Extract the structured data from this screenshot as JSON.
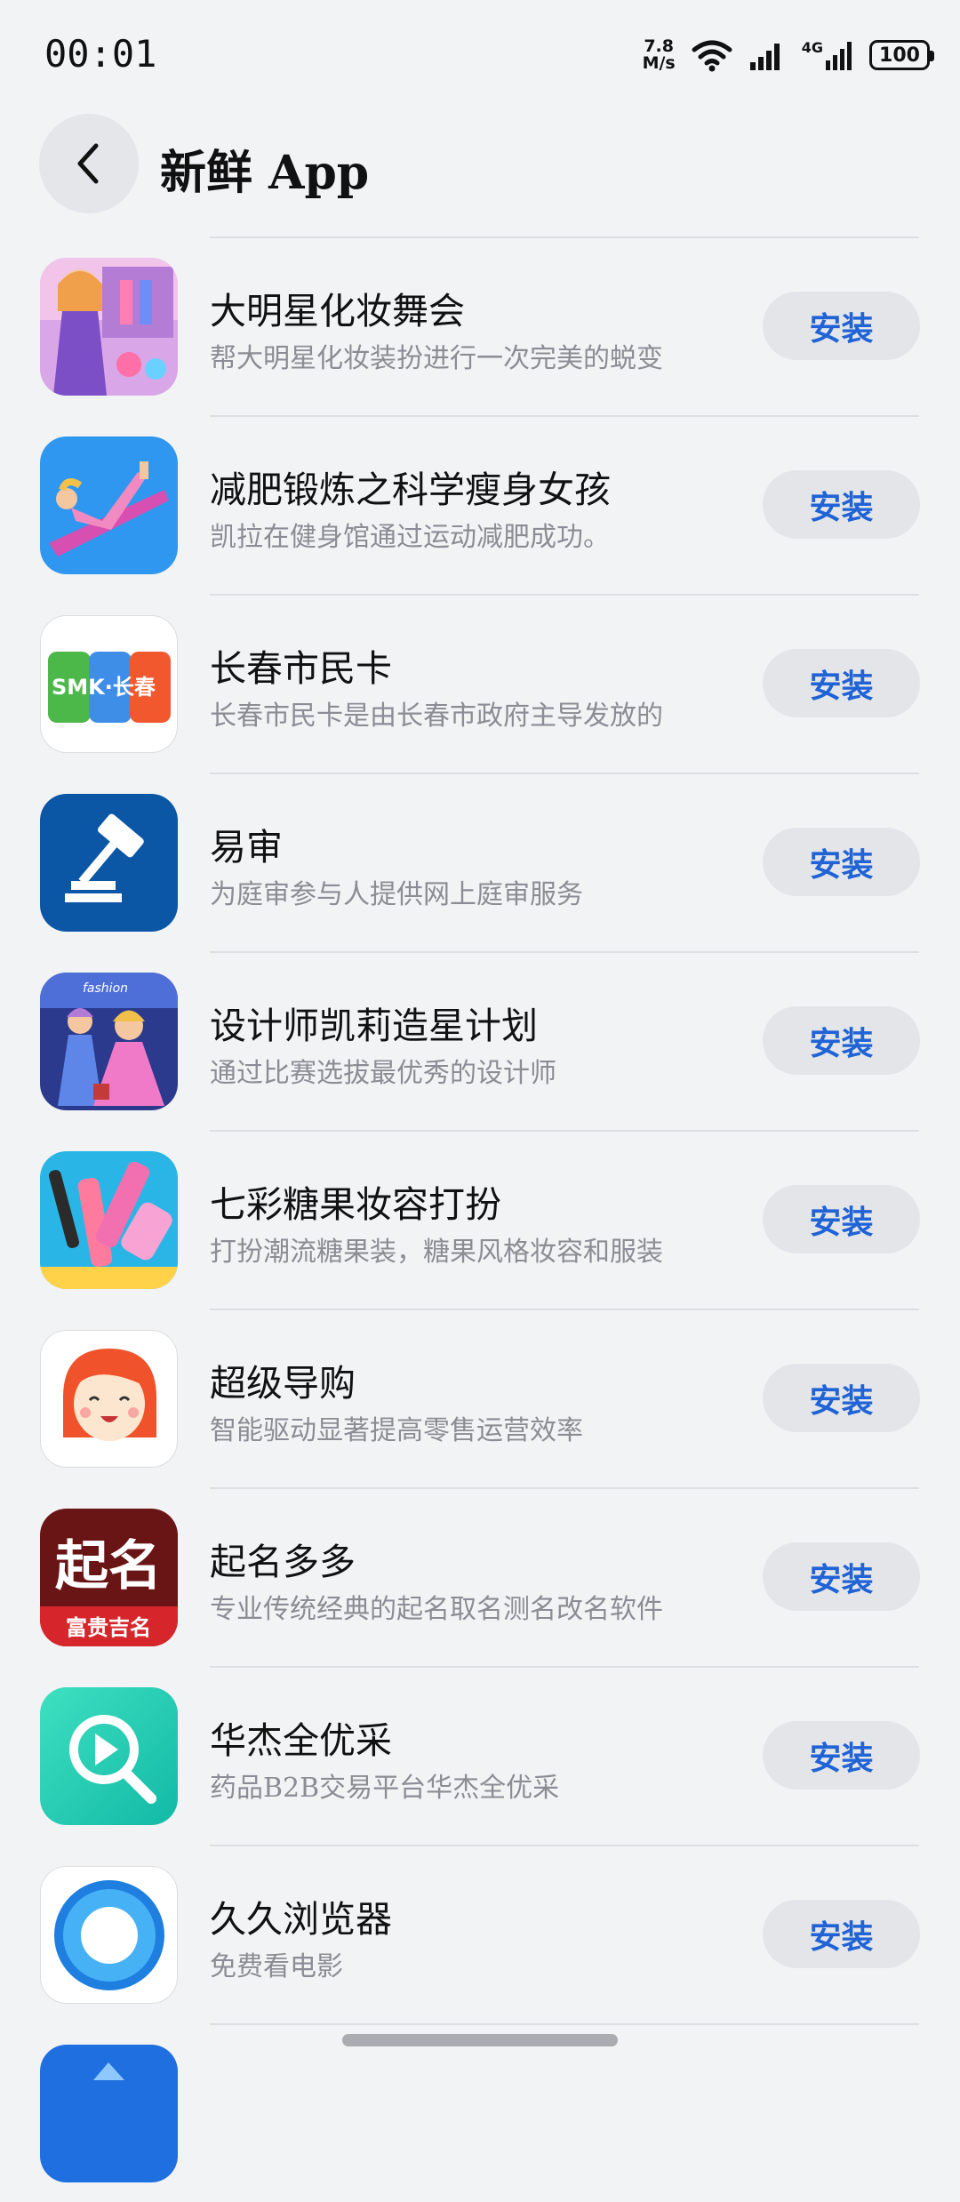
{
  "status_bar": {
    "time": "00:01",
    "net_speed_value": "7.8",
    "net_speed_unit": "M/s",
    "network": "4G",
    "battery": "100"
  },
  "header": {
    "title": "新鲜 App",
    "back_icon": "chevron-left-icon"
  },
  "install_label": "安装",
  "apps": [
    {
      "name": "大明星化妆舞会",
      "desc": "帮大明星化妆装扮进行一次完美的蜕变",
      "icon": "makeup-princess-icon"
    },
    {
      "name": "减肥锻炼之科学瘦身女孩",
      "desc": "凯拉在健身馆通过运动减肥成功。",
      "icon": "fitness-girl-icon"
    },
    {
      "name": "长春市民卡",
      "desc": "长春市民卡是由长春市政府主导发放的",
      "icon": "smk-card-icon",
      "icon_text": "SMK·长春"
    },
    {
      "name": "易审",
      "desc": "为庭审参与人提供网上庭审服务",
      "icon": "gavel-icon"
    },
    {
      "name": "设计师凯莉造星计划",
      "desc": "通过比赛选拔最优秀的设计师",
      "icon": "fashion-designer-icon",
      "icon_text": "fashion"
    },
    {
      "name": "七彩糖果妆容打扮",
      "desc": "打扮潮流糖果装，糖果风格妆容和服装",
      "icon": "candy-makeup-icon"
    },
    {
      "name": "超级导购",
      "desc": "智能驱动显著提高零售运营效率",
      "icon": "smiling-girl-icon"
    },
    {
      "name": "起名多多",
      "desc": "专业传统经典的起名取名测名改名软件",
      "icon": "naming-icon",
      "icon_text": "起名",
      "icon_subtext": "富贵吉名"
    },
    {
      "name": "华杰全优采",
      "desc": "药品B2B交易平台华杰全优采",
      "icon": "search-magnifier-icon"
    },
    {
      "name": "久久浏览器",
      "desc": "免费看电影",
      "icon": "ring-browser-icon"
    },
    {
      "name": "",
      "desc": "",
      "icon": "partial-blue-icon"
    }
  ],
  "colors": {
    "background": "#f1f3f5",
    "install_text": "#1f63d6",
    "install_bg": "#e3e5e8"
  }
}
